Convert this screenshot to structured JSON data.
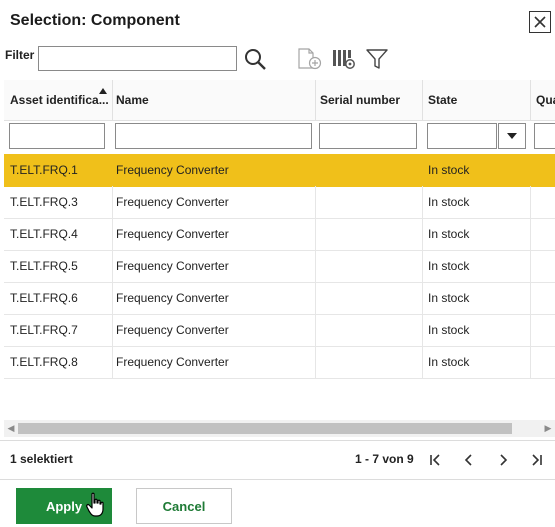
{
  "dialog": {
    "title": "Selection: Component",
    "close_icon": "close-icon"
  },
  "toolbar": {
    "filter_label": "Filter",
    "filter_value": "",
    "icons": [
      "search-icon",
      "new-document-icon",
      "column-settings-icon",
      "funnel-icon"
    ]
  },
  "table": {
    "columns": [
      {
        "label": "Asset identifica...",
        "sorted": "ascending"
      },
      {
        "label": "Name"
      },
      {
        "label": "Serial number"
      },
      {
        "label": "State"
      },
      {
        "label": "Qua"
      }
    ],
    "rows": [
      {
        "asset": "T.ELT.FRQ.1",
        "name": "Frequency Converter",
        "serial": "",
        "state": "In stock",
        "selected": true
      },
      {
        "asset": "T.ELT.FRQ.3",
        "name": "Frequency Converter",
        "serial": "",
        "state": "In stock",
        "selected": false
      },
      {
        "asset": "T.ELT.FRQ.4",
        "name": "Frequency Converter",
        "serial": "",
        "state": "In stock",
        "selected": false
      },
      {
        "asset": "T.ELT.FRQ.5",
        "name": "Frequency Converter",
        "serial": "",
        "state": "In stock",
        "selected": false
      },
      {
        "asset": "T.ELT.FRQ.6",
        "name": "Frequency Converter",
        "serial": "",
        "state": "In stock",
        "selected": false
      },
      {
        "asset": "T.ELT.FRQ.7",
        "name": "Frequency Converter",
        "serial": "",
        "state": "In stock",
        "selected": false
      },
      {
        "asset": "T.ELT.FRQ.8",
        "name": "Frequency Converter",
        "serial": "",
        "state": "In stock",
        "selected": false
      }
    ],
    "selection_color": "#f0c01a"
  },
  "status": {
    "selected_count": "1 selektiert",
    "pager_text": "1 - 7 von 9"
  },
  "buttons": {
    "apply": "Apply",
    "cancel": "Cancel",
    "apply_color": "#1e8a3a"
  }
}
